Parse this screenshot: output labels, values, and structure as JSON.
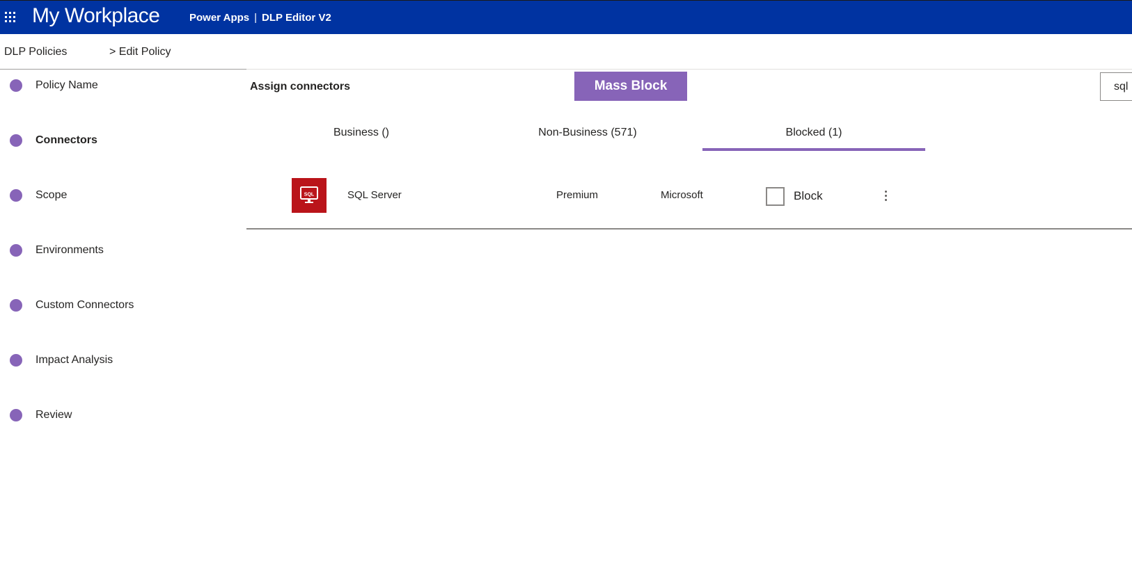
{
  "header": {
    "app_title": "My Workplace",
    "product": "Power Apps",
    "separator": "|",
    "page": "DLP Editor V2"
  },
  "breadcrumb": {
    "root": "DLP Policies",
    "current": "> Edit Policy"
  },
  "steps": [
    {
      "label": "Policy Name",
      "active": false
    },
    {
      "label": "Connectors",
      "active": true
    },
    {
      "label": "Scope",
      "active": false
    },
    {
      "label": "Environments",
      "active": false
    },
    {
      "label": "Custom Connectors",
      "active": false
    },
    {
      "label": "Impact Analysis",
      "active": false
    },
    {
      "label": "Review",
      "active": false
    }
  ],
  "toolbar": {
    "title": "Assign connectors",
    "mass_block_label": "Mass Block",
    "search_value": "sql"
  },
  "tabs": [
    {
      "label": "Business ()",
      "selected": false
    },
    {
      "label": "Non-Business (571)",
      "selected": false
    },
    {
      "label": "Blocked (1)",
      "selected": true
    }
  ],
  "connectors": [
    {
      "icon_text": "SQL",
      "name": "SQL Server",
      "tier": "Premium",
      "publisher": "Microsoft",
      "block_label": "Block",
      "blocked_checked": false
    }
  ],
  "colors": {
    "header_bg": "#0033a1",
    "accent": "#8764b8",
    "connector_icon_bg": "#ba141a"
  },
  "icons": {
    "app_launcher": "waffle-icon",
    "connector": "sql-server-icon",
    "more": "more-vertical-icon"
  }
}
